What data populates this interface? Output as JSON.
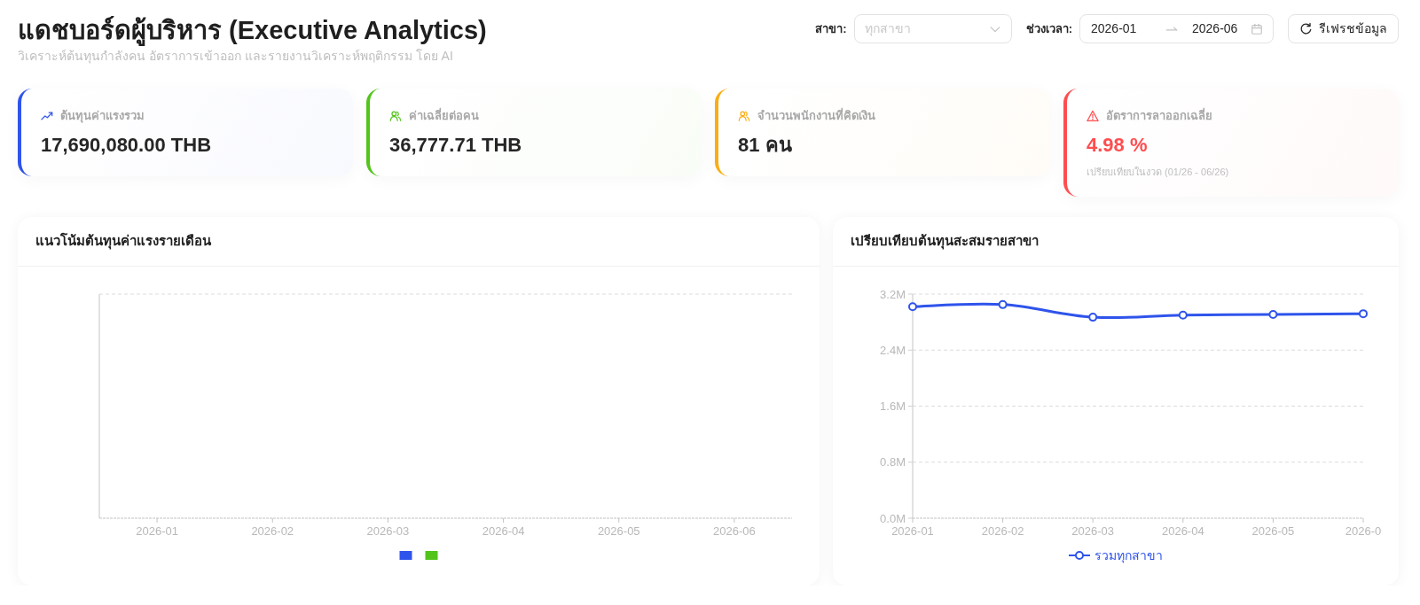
{
  "header": {
    "title": "แดชบอร์ดผู้บริหาร (Executive Analytics)",
    "subtitle": "วิเคราะห์ต้นทุนกำลังคน อัตราการเข้าออก และรายงานวิเคราะห์พฤติกรรม โดย AI"
  },
  "filters": {
    "branch_label": "สาขา:",
    "branch_select": {
      "placeholder": "ทุกสาขา"
    },
    "period_label": "ช่วงเวลา:",
    "period": {
      "start": "2026-01",
      "end": "2026-06"
    },
    "refresh_button": "รีเฟรชข้อมูล"
  },
  "kpis": [
    {
      "kind": "trend",
      "label": "ต้นทุนค่าแรงรวม",
      "value": "17,690,080.00 THB",
      "color": "#2f54eb"
    },
    {
      "kind": "team",
      "label": "ค่าเฉลี่ยต่อคน",
      "value": "36,777.71 THB",
      "color": "#52c41a"
    },
    {
      "kind": "team",
      "label": "จำนวนพนักงานที่คิดเงิน",
      "value": "81 คน",
      "color": "#faad14"
    },
    {
      "kind": "warning",
      "label": "อัตราการลาออกเฉลี่ย",
      "value": "4.98 %",
      "note": "เปรียบเทียบในงวด (01/26 - 06/26)",
      "color": "#ff4d4f"
    }
  ],
  "charts": [
    {
      "title": "แนวโน้มต้นทุนค่าแรงรายเดือน",
      "x_labels": [
        "2026-01",
        "2026-02",
        "2026-03",
        "2026-04",
        "2026-05",
        "2026-06"
      ],
      "legend": [
        {
          "color": "#2f54eb"
        },
        {
          "color": "#52c41a"
        }
      ]
    },
    {
      "title": "เปรียบเทียบต้นทุนสะสมรายสาขา",
      "chart_data": {
        "type": "line",
        "grid": true,
        "categories": [
          "2026-01",
          "2026-02",
          "2026-03",
          "2026-04",
          "2026-05",
          "2026-0"
        ],
        "series": [
          {
            "name": "รวมทุกสาขา",
            "color": "#2f54eb",
            "marker": "circle",
            "values": [
              3020000,
              3050000,
              2870000,
              2900000,
              2910000,
              2920000
            ]
          }
        ],
        "ylim": [
          0,
          3200000
        ],
        "yticks": [
          {
            "value": 0,
            "label": "0.0M"
          },
          {
            "value": 800000,
            "label": "0.8M"
          },
          {
            "value": 1600000,
            "label": "1.6M"
          },
          {
            "value": 2400000,
            "label": "2.4M"
          },
          {
            "value": 3200000,
            "label": "3.2M"
          }
        ]
      }
    }
  ]
}
